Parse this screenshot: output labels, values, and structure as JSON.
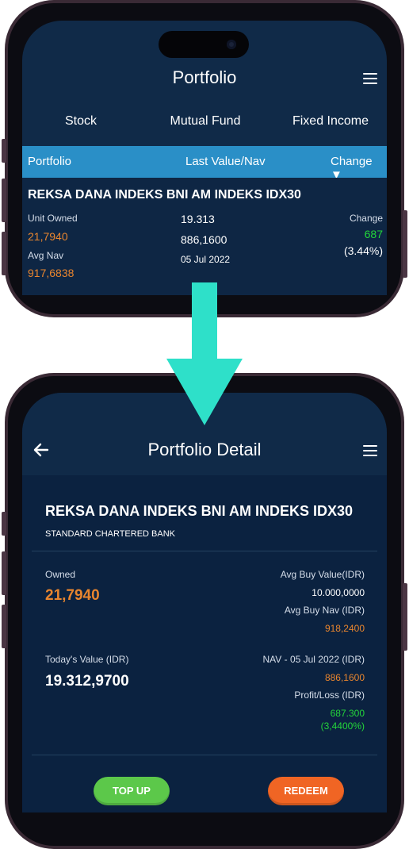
{
  "top": {
    "title": "Portfolio",
    "tabs": [
      "Stock",
      "Mutual Fund",
      "Fixed Income"
    ],
    "active_tab": "Mutual Fund",
    "table_header": {
      "col1": "Portfolio",
      "col2": "Last Value/Nav",
      "col3": "Change ▼"
    },
    "fund": {
      "name": "REKSA DANA INDEKS BNI AM INDEKS IDX30",
      "unit_owned_label": "Unit Owned",
      "unit_owned": "21,7940",
      "avg_nav_label": "Avg Nav",
      "avg_nav": "917,6838",
      "last_value": "19.313",
      "nav": "886,1600",
      "date": "05 Jul 2022",
      "change_label": "Change",
      "change_value": "687",
      "change_pct": "(3.44%)"
    }
  },
  "detail": {
    "title": "Portfolio Detail",
    "fund_name": "REKSA DANA INDEKS BNI AM INDEKS IDX30",
    "bank": "STANDARD CHARTERED BANK",
    "owned_label": "Owned",
    "owned": "21,7940",
    "avg_buy_value_label": "Avg Buy Value(IDR)",
    "avg_buy_value": "10.000,0000",
    "avg_buy_nav_label": "Avg Buy Nav (IDR)",
    "avg_buy_nav": "918,2400",
    "todays_value_label": "Today's Value (IDR)",
    "todays_value": "19.312,9700",
    "nav_label": "NAV - 05 Jul 2022 (IDR)",
    "nav": "886,1600",
    "profit_loss_label": "Profit/Loss (IDR)",
    "profit_loss": "687.300",
    "profit_loss_pct": "(3,4400%)",
    "top_up_label": "TOP UP",
    "redeem_label": "REDEEM"
  },
  "colors": {
    "accent_orange": "#e8852e",
    "positive_green": "#23d63a",
    "header_blue": "#2a8fc7",
    "arrow_teal": "#2ee0c9",
    "top_up_green": "#5cc84a",
    "redeem_orange": "#f06524"
  },
  "icons": [
    "menu-icon",
    "back-arrow-icon",
    "down-arrow-icon"
  ]
}
